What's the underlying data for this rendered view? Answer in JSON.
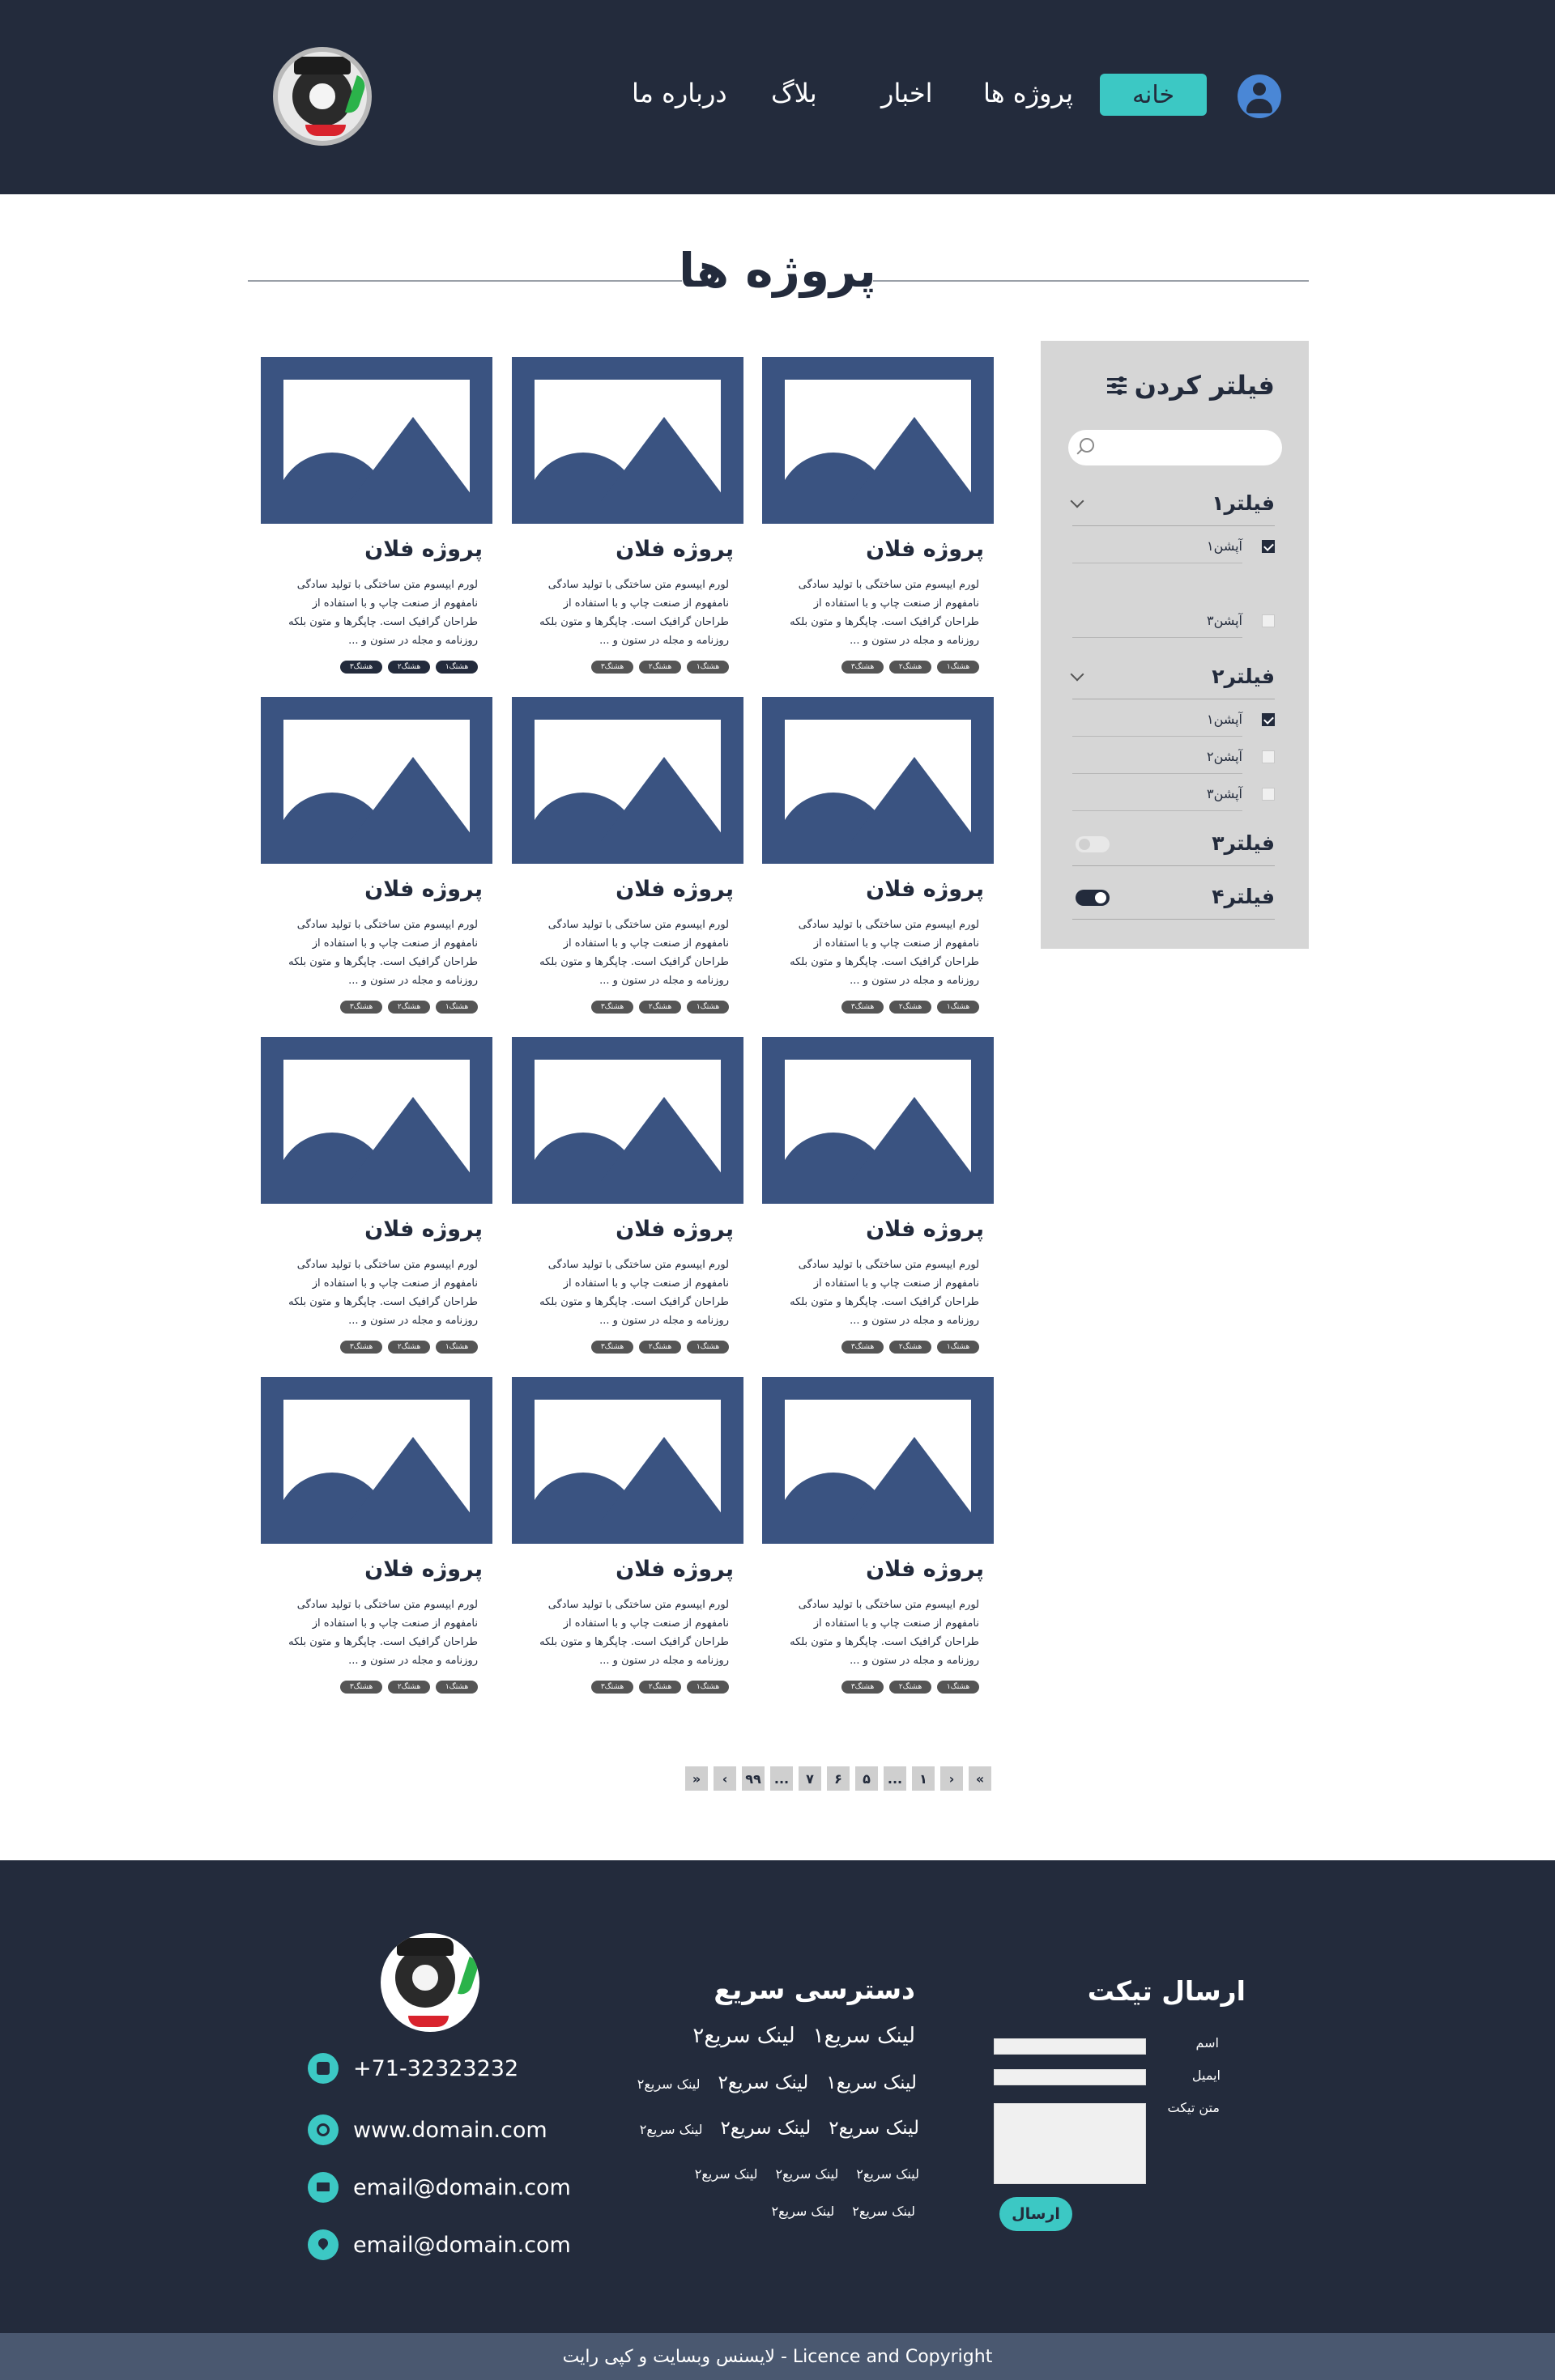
{
  "colors": {
    "navy": "#232b3c",
    "accent": "#3cc8c4",
    "thumb": "#3a5381",
    "avatar": "#4a87d6",
    "panel": "#d6d6d6"
  },
  "header": {
    "logo_icon": "brand-logo",
    "nav": [
      {
        "label": "خانه",
        "active": true
      },
      {
        "label": "پروژه ها"
      },
      {
        "label": "اخبار"
      },
      {
        "label": "بلاگ"
      },
      {
        "label": "درباره ما"
      }
    ],
    "user_icon": "user-avatar-icon"
  },
  "page": {
    "title": "پروژه ها"
  },
  "filter": {
    "title": "فیلتر کردن",
    "search_placeholder": "",
    "groups": [
      {
        "label": "فیلتر۱",
        "options": [
          {
            "label": "آپشن۱",
            "checked": true
          },
          {
            "label": "آپشن۳",
            "checked": false
          }
        ]
      },
      {
        "label": "فیلتر۲",
        "options": [
          {
            "label": "آپشن۱",
            "checked": true
          },
          {
            "label": "آپشن۲",
            "checked": false
          },
          {
            "label": "آپشن۳",
            "checked": false
          }
        ]
      },
      {
        "label": "فیلتر۳",
        "toggle": false
      },
      {
        "label": "فیلتر۴",
        "toggle": true
      }
    ]
  },
  "cards": [
    {
      "title": "پروژه فلان",
      "desc": "لورم ایپسوم متن ساختگی با تولید سادگی نامفهوم از صنعت چاپ و با استفاده از طراحان گرافیک است. چاپگرها و متون بلکه روزنامه و مجله در ستون و ...",
      "tags": [
        "هشتگ۱",
        "هشتگ۲",
        "هشتگ۳"
      ]
    },
    {
      "title": "پروژه فلان",
      "desc": "لورم ایپسوم متن ساختگی با تولید سادگی نامفهوم از صنعت چاپ و با استفاده از طراحان گرافیک است. چاپگرها و متون بلکه روزنامه و مجله در ستون و ...",
      "tags": [
        "هشتگ۱",
        "هشتگ۲",
        "هشتگ۳"
      ]
    },
    {
      "title": "پروژه فلان",
      "desc": "لورم ایپسوم متن ساختگی با تولید سادگی نامفهوم از صنعت چاپ و با استفاده از طراحان گرافیک است. چاپگرها و متون بلکه روزنامه و مجله در ستون و ...",
      "tags": [
        "هشتگ۱",
        "هشتگ۲",
        "هشتگ۳"
      ]
    },
    {
      "title": "پروژه فلان",
      "desc": "لورم ایپسوم متن ساختگی با تولید سادگی نامفهوم از صنعت چاپ و با استفاده از طراحان گرافیک است. چاپگرها و متون بلکه روزنامه و مجله در ستون و ...",
      "tags": [
        "هشتگ۱",
        "هشتگ۲",
        "هشتگ۳"
      ]
    },
    {
      "title": "پروژه فلان",
      "desc": "لورم ایپسوم متن ساختگی با تولید سادگی نامفهوم از صنعت چاپ و با استفاده از طراحان گرافیک است. چاپگرها و متون بلکه روزنامه و مجله در ستون و ...",
      "tags": [
        "هشتگ۱",
        "هشتگ۲",
        "هشتگ۳"
      ]
    },
    {
      "title": "پروژه فلان",
      "desc": "لورم ایپسوم متن ساختگی با تولید سادگی نامفهوم از صنعت چاپ و با استفاده از طراحان گرافیک است. چاپگرها و متون بلکه روزنامه و مجله در ستون و ...",
      "tags": [
        "هشتگ۱",
        "هشتگ۲",
        "هشتگ۳"
      ]
    },
    {
      "title": "پروژه فلان",
      "desc": "لورم ایپسوم متن ساختگی با تولید سادگی نامفهوم از صنعت چاپ و با استفاده از طراحان گرافیک است. چاپگرها و متون بلکه روزنامه و مجله در ستون و ...",
      "tags": [
        "هشتگ۱",
        "هشتگ۲",
        "هشتگ۳"
      ]
    },
    {
      "title": "پروژه فلان",
      "desc": "لورم ایپسوم متن ساختگی با تولید سادگی نامفهوم از صنعت چاپ و با استفاده از طراحان گرافیک است. چاپگرها و متون بلکه روزنامه و مجله در ستون و ...",
      "tags": [
        "هشتگ۱",
        "هشتگ۲",
        "هشتگ۳"
      ]
    },
    {
      "title": "پروژه فلان",
      "desc": "لورم ایپسوم متن ساختگی با تولید سادگی نامفهوم از صنعت چاپ و با استفاده از طراحان گرافیک است. چاپگرها و متون بلکه روزنامه و مجله در ستون و ...",
      "tags": [
        "هشتگ۱",
        "هشتگ۲",
        "هشتگ۳"
      ]
    },
    {
      "title": "پروژه فلان",
      "desc": "لورم ایپسوم متن ساختگی با تولید سادگی نامفهوم از صنعت چاپ و با استفاده از طراحان گرافیک است. چاپگرها و متون بلکه روزنامه و مجله در ستون و ...",
      "tags": [
        "هشتگ۱",
        "هشتگ۲",
        "هشتگ۳"
      ]
    },
    {
      "title": "پروژه فلان",
      "desc": "لورم ایپسوم متن ساختگی با تولید سادگی نامفهوم از صنعت چاپ و با استفاده از طراحان گرافیک است. چاپگرها و متون بلکه روزنامه و مجله در ستون و ...",
      "tags": [
        "هشتگ۱",
        "هشتگ۲",
        "هشتگ۳"
      ]
    },
    {
      "title": "پروژه فلان",
      "desc": "لورم ایپسوم متن ساختگی با تولید سادگی نامفهوم از صنعت چاپ و با استفاده از طراحان گرافیک است. چاپگرها و متون بلکه روزنامه و مجله در ستون و ...",
      "tags": [
        "هشتگ۱",
        "هشتگ۲",
        "هشتگ۳"
      ]
    }
  ],
  "pagination": [
    "»",
    "‹",
    "۹۹",
    "...",
    "۷",
    "۶",
    "۵",
    "...",
    "۱",
    "›",
    "«"
  ],
  "footer": {
    "contacts": [
      {
        "icon": "phone-icon",
        "text": "+71-32323232"
      },
      {
        "icon": "globe-icon",
        "text": "www.domain.com"
      },
      {
        "icon": "mail-icon",
        "text": "email@domain.com"
      },
      {
        "icon": "location-pin-icon",
        "text": "email@domain.com"
      }
    ],
    "quick_links_title": "دسترسی سریع",
    "quick_links": [
      [
        "لینک سریع۱",
        "لینک سریع۲"
      ],
      [
        "لینک سریع۱",
        "لینک سریع۲",
        "لینک سریع۲"
      ],
      [
        "لینک سریع۲",
        "لینک سریع۲",
        "لینک سریع۲"
      ],
      [
        "لینک سریع۲",
        "لینک سریع۲",
        "لینک سریع۲"
      ],
      [
        "لینک سریع۲",
        "لینک سریع۲"
      ]
    ],
    "ticket_title": "ارسال تیکت",
    "ticket_fields": {
      "name": "اسم",
      "email": "ایمیل",
      "body": "متن تیکت"
    },
    "ticket_send": "ارسال",
    "copyright": "لایسنس وبسایت و کپی رایت - Licence and Copyright"
  }
}
